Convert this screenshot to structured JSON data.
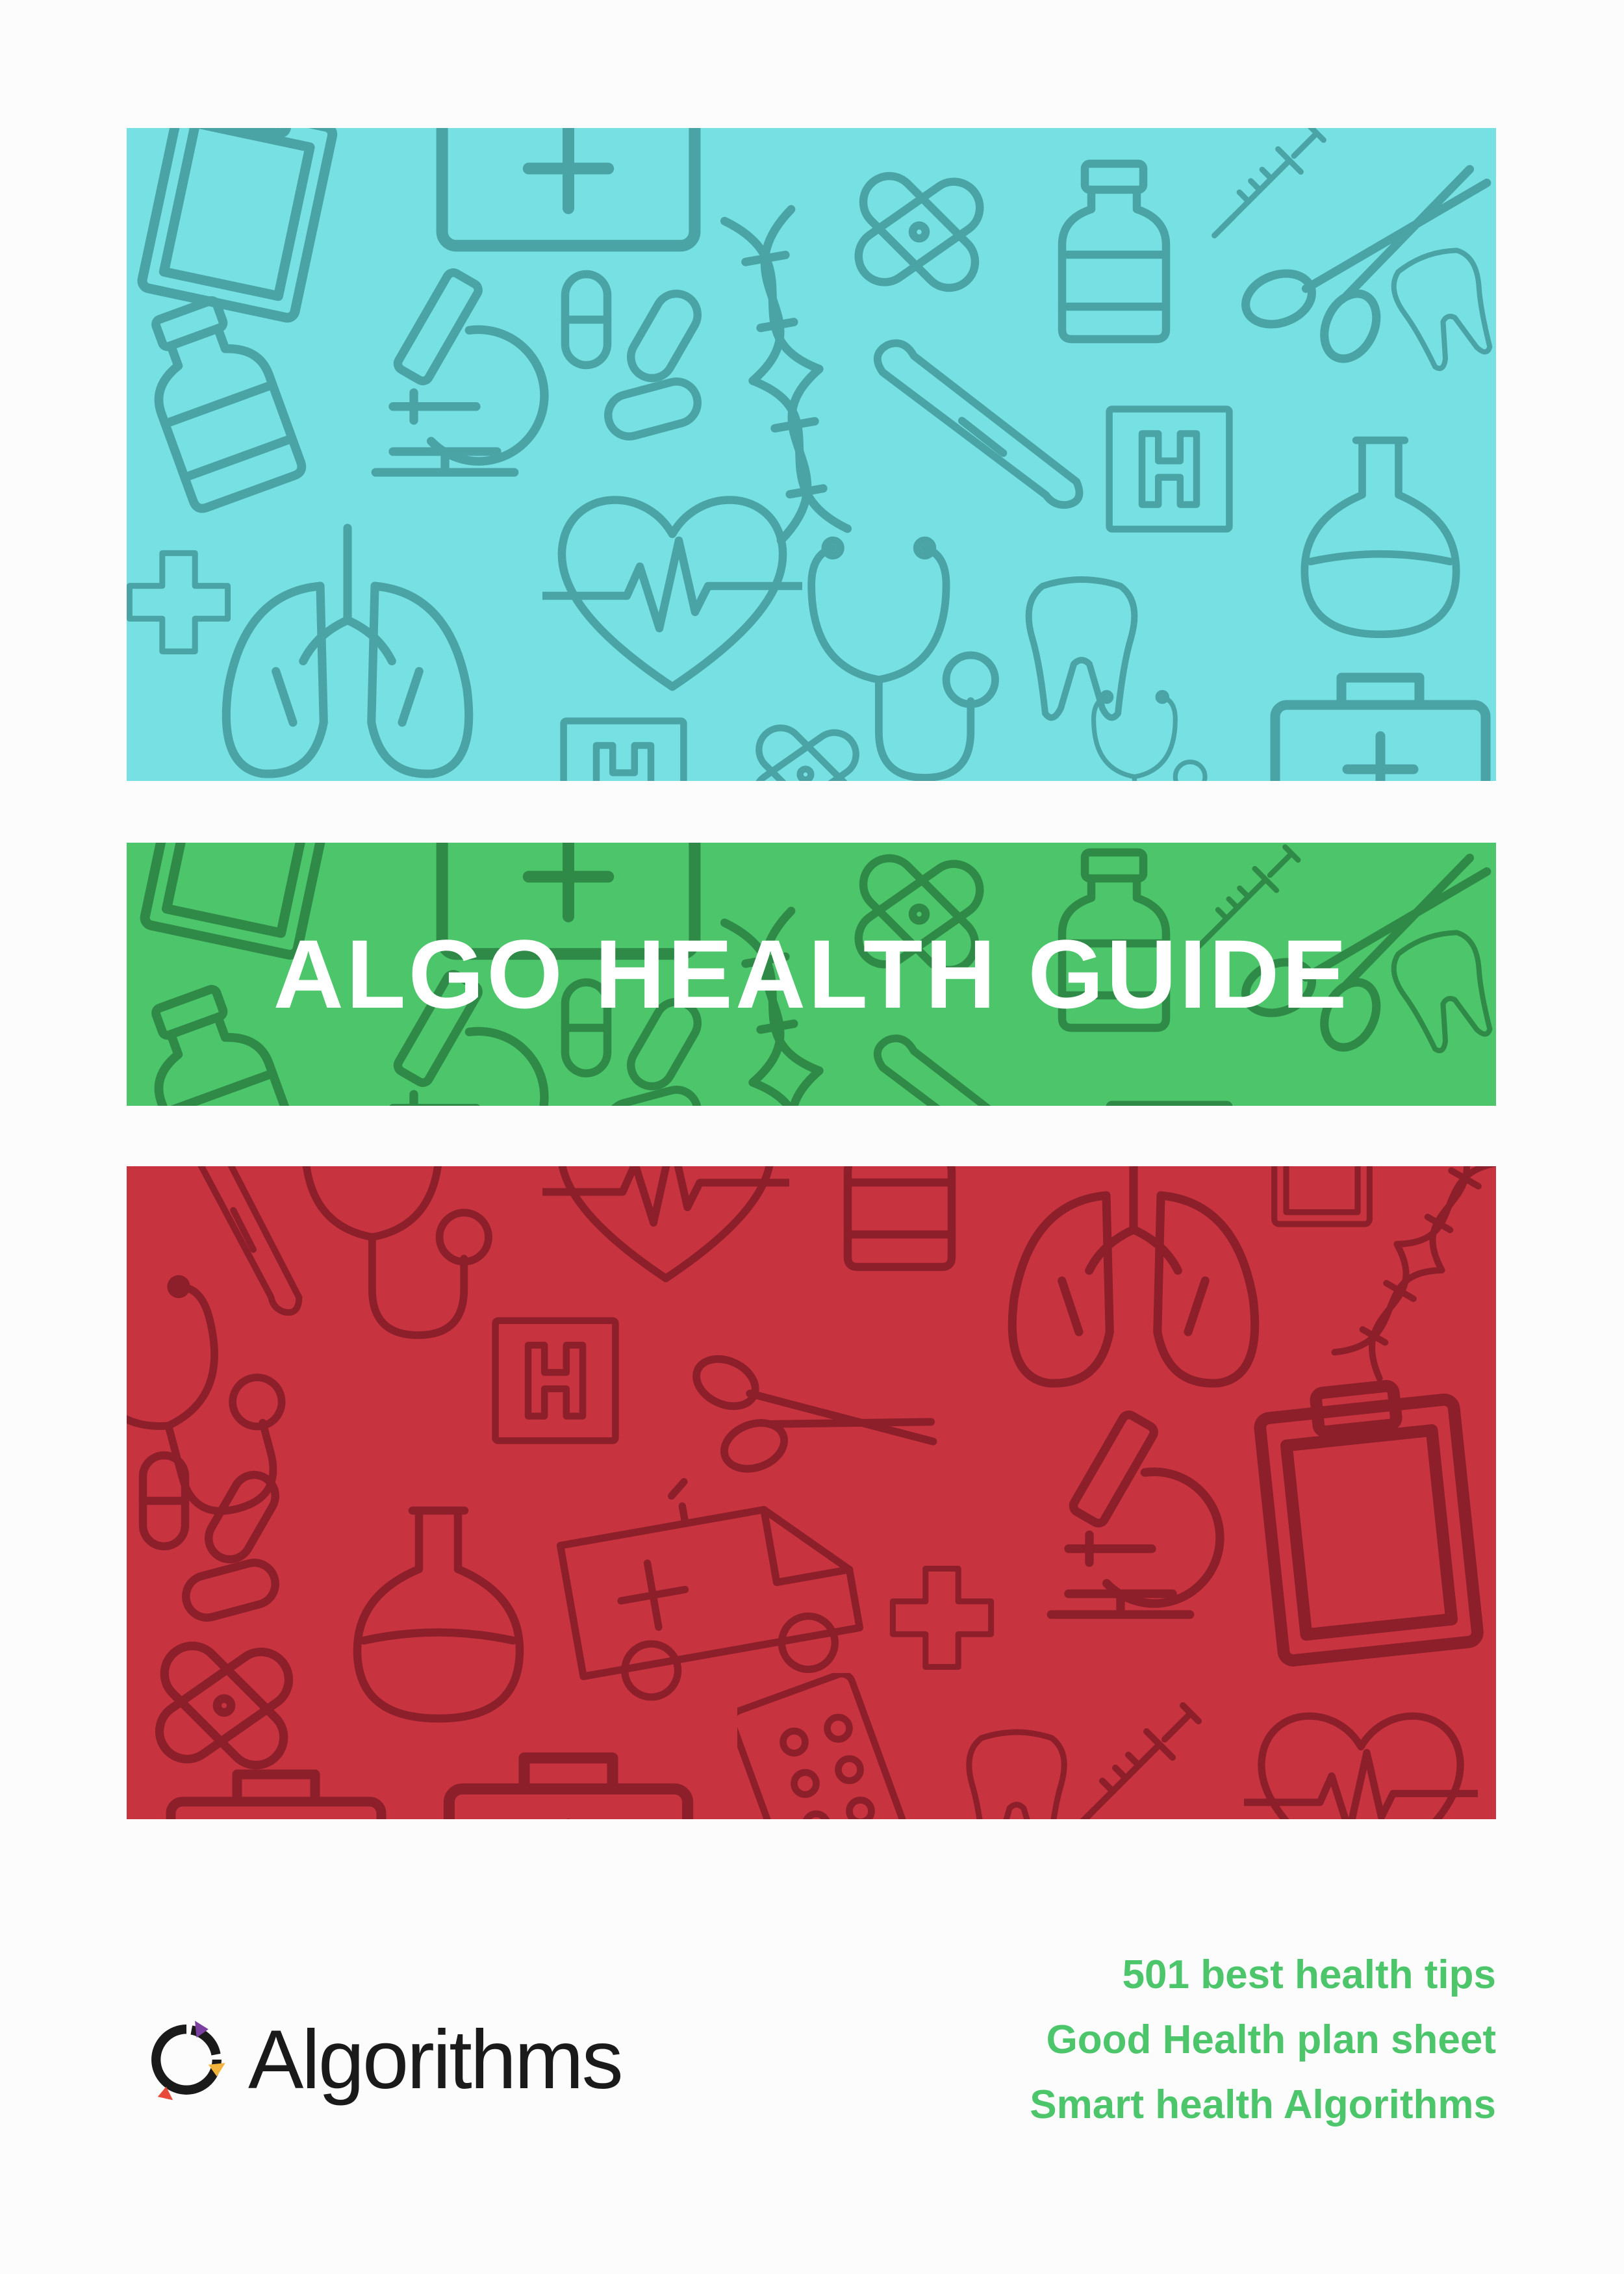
{
  "cover": {
    "title": "ALGO HEALTH GUIDE",
    "colors": {
      "blue_band": "#76e0e3",
      "green_band": "#4cc56b",
      "red_band": "#c83340",
      "blue_doodle": "#4aa4a6",
      "green_doodle": "#2f8a47",
      "red_doodle": "#8c1f2a",
      "tips_text": "#4cc56b"
    },
    "doodle_icons": [
      "clipboard-icon",
      "first-aid-kit-icon",
      "bandage-icon",
      "medicine-bottle-icon",
      "syringe-icon",
      "scissors-icon",
      "microscope-icon",
      "pills-icon",
      "dna-icon",
      "thermometer-icon",
      "hospital-sign-icon",
      "flask-icon",
      "heart-pulse-icon",
      "lungs-icon",
      "stethoscope-icon",
      "tooth-icon",
      "ambulance-icon",
      "cross-icon",
      "pill-blister-icon"
    ]
  },
  "logo": {
    "name": "Algorithms",
    "colors": [
      "#7b3fa0",
      "#e84a3a",
      "#f2b33d",
      "#1a1a1a"
    ]
  },
  "tips": [
    "501 best health tips",
    "Good Health plan sheet",
    "Smart health Algorithms"
  ]
}
